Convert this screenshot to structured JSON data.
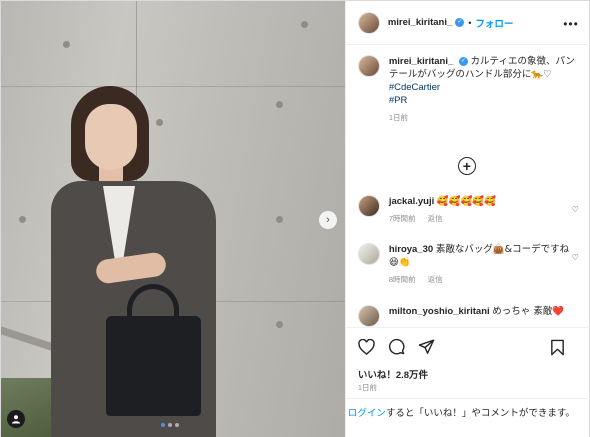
{
  "post": {
    "username": "mirei_kiritani_",
    "separator": "•",
    "follow_label": "フォロー",
    "more_label": "•••"
  },
  "caption": {
    "username": "mirei_kiritani_",
    "text": "カルティエの象徴、パンテールがバッグのハンドル部分に",
    "text_emoji": "🐆♡",
    "hashtags": [
      "#CdeCartier",
      "#PR"
    ],
    "time": "1日前"
  },
  "comments": [
    {
      "username": "jackal.yuji",
      "text": "🥰🥰🥰🥰🥰",
      "time": "7時間前",
      "reply_label": "返信"
    },
    {
      "username": "hiroya_30",
      "text": "素敵なバッグ👜&コーデですね😆👏",
      "time": "8時間前",
      "reply_label": "返信"
    },
    {
      "username": "milton_yoshio_kiritani",
      "text": "めっちゃ 素敵❤️",
      "time": "",
      "reply_label": ""
    }
  ],
  "likes_text": "いいね！2.8万件",
  "date_text": "1日前",
  "login_prompt": {
    "link": "ログイン",
    "text": "すると「いいね！」やコメントができます。"
  },
  "carousel": {
    "slide_count": 3,
    "active_index": 0
  },
  "colors": {
    "accent": "#0095f6",
    "hashtag": "#00376b",
    "muted": "#8e8e8e",
    "verified": "#3897f0"
  },
  "icons": [
    "heart-icon",
    "comment-icon",
    "share-icon",
    "bookmark-icon",
    "plus-circle-icon",
    "chevron-right-icon",
    "user-tag-icon"
  ]
}
